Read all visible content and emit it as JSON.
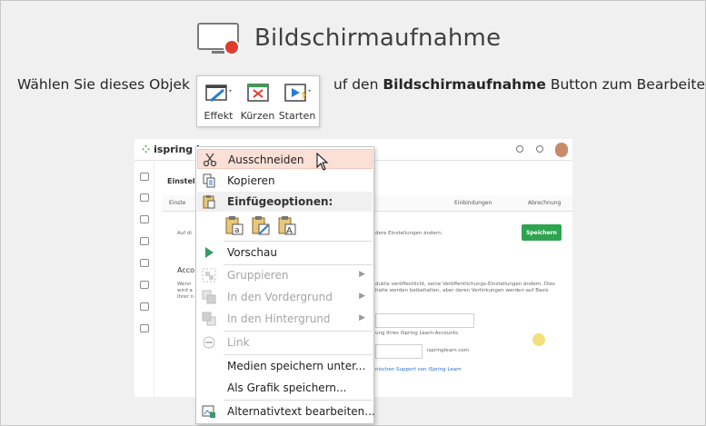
{
  "slide": {
    "title": "Bildschirmaufnahme",
    "subtitle_before": "Wählen Sie dieses Objek",
    "subtitle_mid": "uf den ",
    "subtitle_bold": "Bildschirmaufnahme",
    "subtitle_after": " Button zum Bearbeiten"
  },
  "mini_toolbar": {
    "effect_label": "Effekt",
    "trim_label": "Kürzen",
    "start_label": "Starten"
  },
  "embedded_screenshot": {
    "logo": "ispring le",
    "section_title": "Einstell",
    "tab_first": "Einste",
    "tab_integrations": "Einbindungen",
    "tab_billing": "Abrechnung",
    "text_top_left": "Auf di",
    "text_top_right": "dere Einstellungen ändern.",
    "save_label": "Speichern",
    "section_acc": "Acco",
    "left_lines": [
      "Wenn",
      "wird a",
      "Ihrer n"
    ],
    "right_lines": [
      "dukte veröffentlicht, seine Veröffentlichungs-Einstellungen ändern. Dies",
      "halte werden beibehalten, aber deren Verlinkungen werden auf Basis"
    ],
    "hint_account": "ung Ihres iSpring Learn-Accounts.",
    "domain_suffix": "ispringlearn.com",
    "support_link": "nischen Support von iSpring Learn"
  },
  "context_menu": {
    "cut": "Ausschneiden",
    "copy": "Kopieren",
    "paste_options": "Einfügeoptionen:",
    "preview": "Vorschau",
    "group": "Gruppieren",
    "bring_front": "In den Vordergrund",
    "send_back": "In den Hintergrund",
    "link": "Link",
    "save_media": "Medien speichern unter...",
    "save_as_picture": "Als Grafik speichern...",
    "edit_alt_text": "Alternativtext bearbeiten..."
  },
  "colors": {
    "hover": "#fbe0d8",
    "accent_green": "#2fa44f",
    "record_red": "#e03c31"
  }
}
